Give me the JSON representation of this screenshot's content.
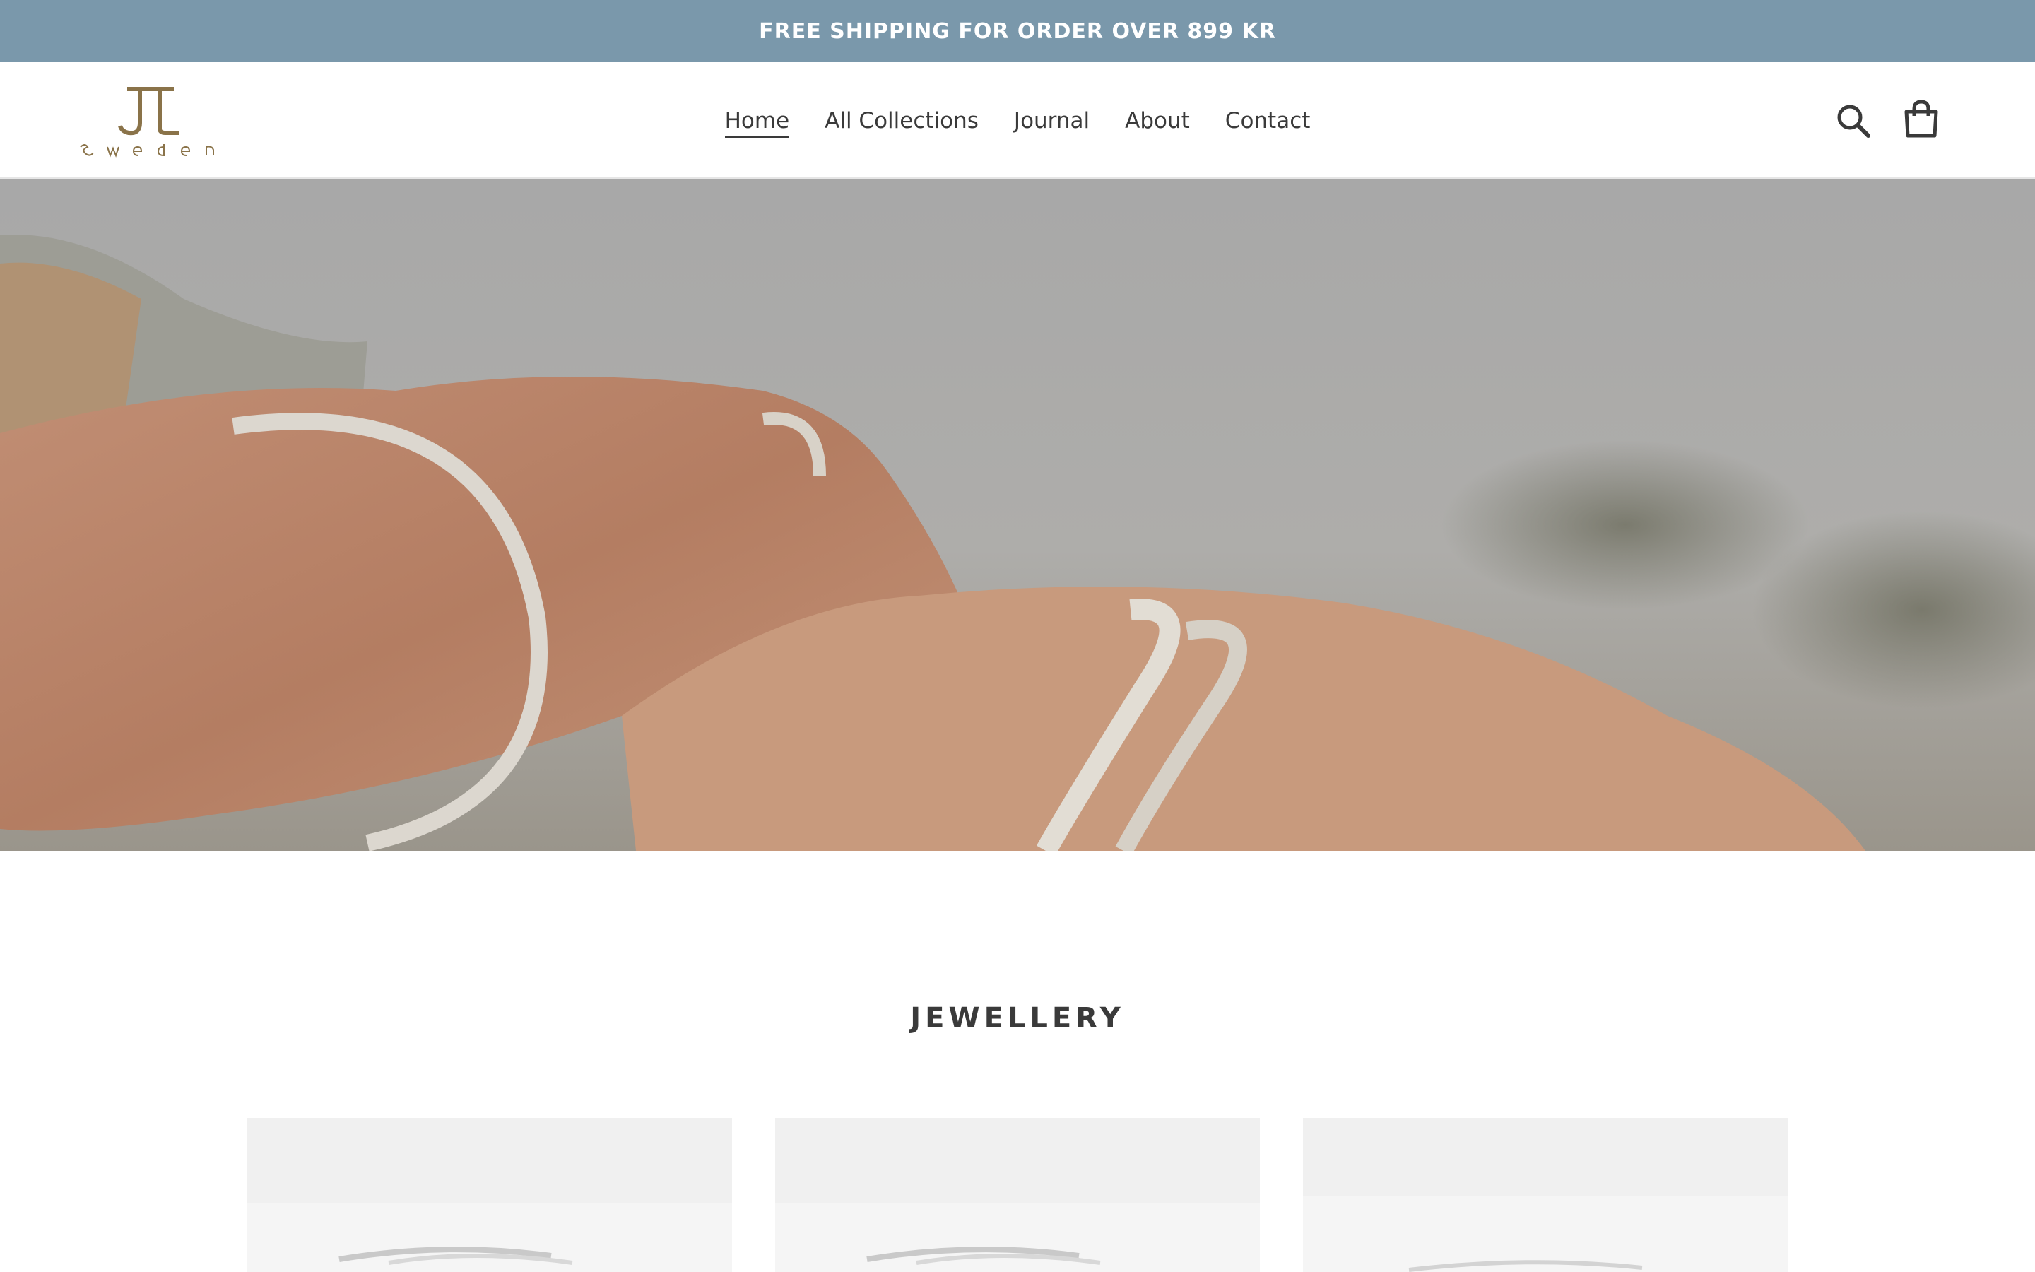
{
  "announcement": {
    "text": "FREE SHIPPING FOR ORDER OVER 899 KR"
  },
  "header": {
    "logo": {
      "monogram": "JL",
      "wordmark": "Sweden",
      "color": "#8a7349"
    },
    "nav": [
      {
        "label": "Home",
        "active": true
      },
      {
        "label": "All Collections",
        "active": false
      },
      {
        "label": "Journal",
        "active": false
      },
      {
        "label": "About",
        "active": false
      },
      {
        "label": "Contact",
        "active": false
      }
    ],
    "icons": {
      "search": "search-icon",
      "cart": "cart-icon"
    }
  },
  "hero": {
    "image": "hands-wearing-silver-bangles"
  },
  "collection": {
    "title": "JEWELLERY",
    "products": [
      {
        "image": "silver-bangle-product"
      },
      {
        "image": "silver-bangle-product"
      },
      {
        "image": "silver-bangle-product"
      }
    ]
  },
  "colors": {
    "announcement_bg": "#7a98ab",
    "text": "#3a3a3a",
    "brand": "#8a7349"
  }
}
